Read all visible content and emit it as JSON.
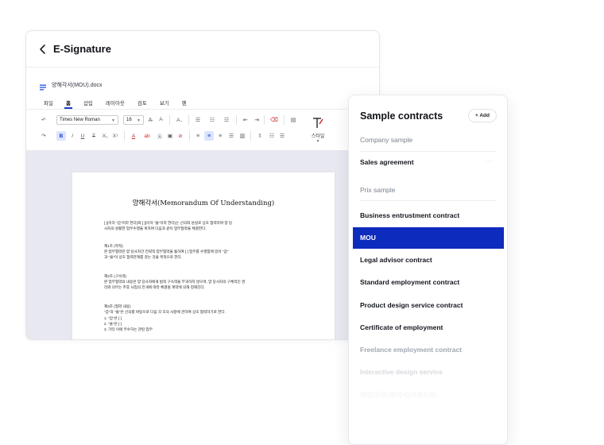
{
  "editor": {
    "title": "E-Signature",
    "doc_name": "양해각서(MOU).docx",
    "tabs": [
      {
        "label": "파일"
      },
      {
        "label": "홈"
      },
      {
        "label": "삽입"
      },
      {
        "label": "레이아웃"
      },
      {
        "label": "검토"
      },
      {
        "label": "보기"
      },
      {
        "label": "펜"
      }
    ],
    "toolbar": {
      "font_family": "Times New Roman",
      "font_size": "16",
      "style_label": "스타일"
    },
    "document": {
      "title": "양해각서(Memorandum Of Understanding)",
      "lines": [
        "[          ](이하 \"갑\"이라 한다)와 [          ](이하 \"을\"이라 한다)는 신의와 성실로 상호 협력하여 양 당",
        "사자의 원활한 업무수행을 위하여 다음과 같이 업무협약을 체결한다.",
        "제1조 (목적)",
        "본 업무협약은 양 당사자간 전략적 업무협약을 통하여 [                    ] 업무를 수행함에 있어 \"갑\"",
        "과 \"을\"이 상호 협력관계를 갖는 것을 목적으로 한다.",
        "제2조 (구속력)",
        "본 업무협약의 내용은 양 당사자에게 법적 구속력을 부과하지 않으며, 양 당사자의 구체적인 권",
        "리와 의무는 추후 사업의 전개에 따라 체결될 계약에 의해 정해진다.",
        "제3조 (협약 내용)",
        "\"갑\"과 \"을\"은 신의를 바탕으로 다음 각 호의 사항에 관하여 상호 협력하기로 한다.",
        "1.      \"갑\"은 [                    ]",
        "2.      \"을\"은 [                    ]",
        "3.      기타 이에 부수하는 관련 업무"
      ]
    }
  },
  "panel": {
    "title": "Sample contracts",
    "add_label": "+ Add",
    "company_section": "Company sample",
    "company_items": [
      "Sales agreement"
    ],
    "prix_section": "Prix sample",
    "prix_items": [
      "Business entrustment contract",
      "MOU",
      "Legal advisor contract",
      "Standard employment contract",
      "Product design service contract",
      "Certificate of employment",
      "Freelance employment contract",
      "Interactive design service",
      "위임(자문)계약서(기술자문)"
    ],
    "selected_item": "MOU",
    "accent_color": "#0d2bbd"
  }
}
